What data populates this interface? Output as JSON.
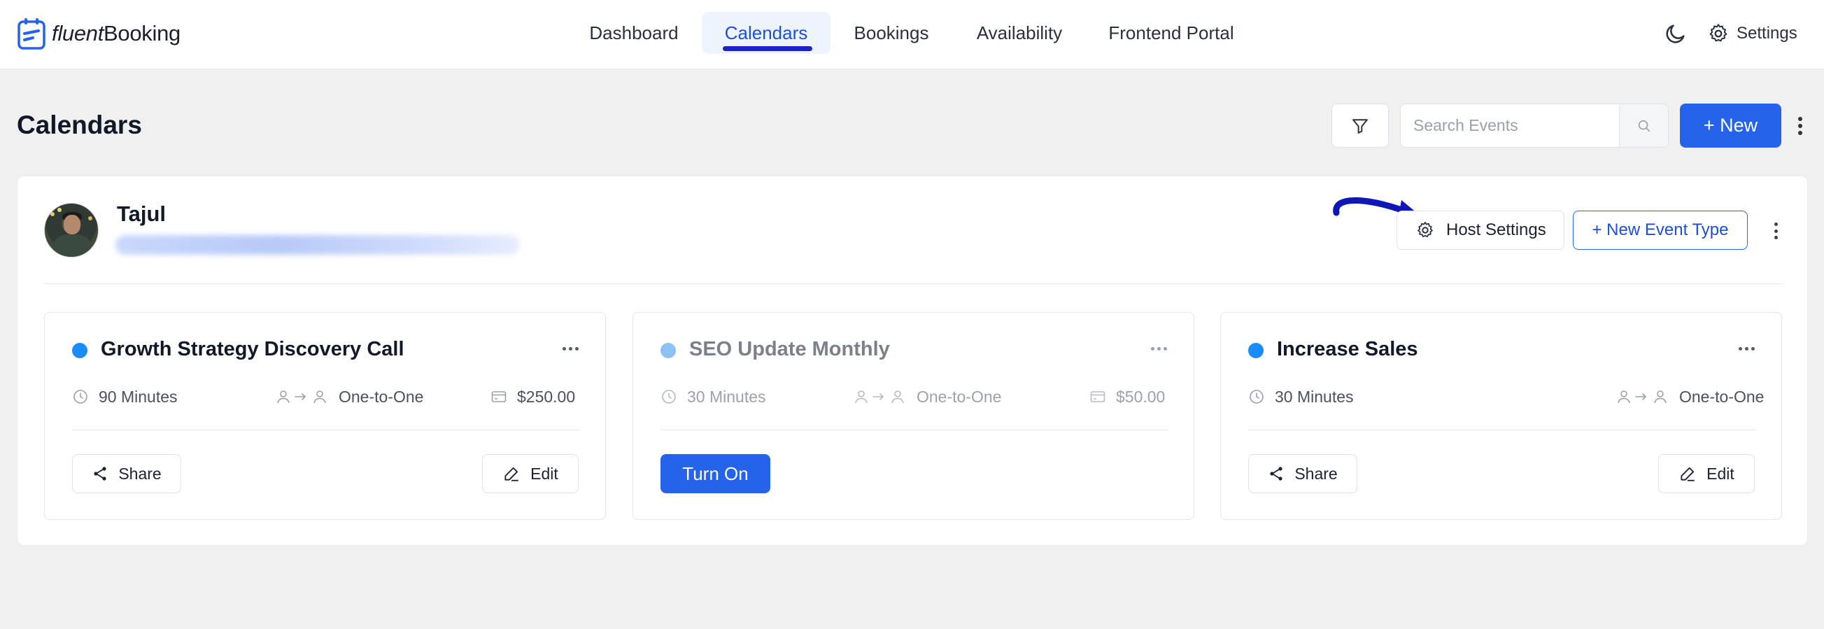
{
  "brand": {
    "name_part1": "fluent",
    "name_part2": "Booking",
    "icon": "fluentbooking-logo-icon"
  },
  "nav": {
    "items": [
      {
        "label": "Dashboard",
        "active": false
      },
      {
        "label": "Calendars",
        "active": true
      },
      {
        "label": "Bookings",
        "active": false
      },
      {
        "label": "Availability",
        "active": false
      },
      {
        "label": "Frontend Portal",
        "active": false
      }
    ],
    "theme_icon": "moon-icon",
    "settings_label": "Settings",
    "settings_icon": "gear-icon"
  },
  "page": {
    "title": "Calendars",
    "search_placeholder": "Search Events",
    "new_label": "+ New",
    "filter_icon": "filter-icon",
    "search_icon": "search-icon"
  },
  "host": {
    "name": "Tajul",
    "email": "",
    "host_settings_label": "Host Settings",
    "new_event_type_label": "+ New Event Type",
    "annotation": "arrow pointing to Host Settings"
  },
  "events": [
    {
      "title": "Growth Strategy Discovery Call",
      "enabled": true,
      "duration": "90 Minutes",
      "type": "One-to-One",
      "price": "$250.00",
      "share_label": "Share",
      "edit_label": "Edit",
      "status_color": "#1a8cff"
    },
    {
      "title": "SEO Update Monthly",
      "enabled": false,
      "duration": "30 Minutes",
      "type": "One-to-One",
      "price": "$50.00",
      "turn_on_label": "Turn On",
      "status_color": "#8cc2f5"
    },
    {
      "title": "Increase Sales",
      "enabled": true,
      "duration": "30 Minutes",
      "type": "One-to-One",
      "share_label": "Share",
      "edit_label": "Edit",
      "status_color": "#1a8cff"
    }
  ],
  "colors": {
    "accent": "#2563eb",
    "nav_active_bg": "#eef4fd",
    "nav_underline": "#1c23c4",
    "page_bg": "#f0f0f1"
  }
}
